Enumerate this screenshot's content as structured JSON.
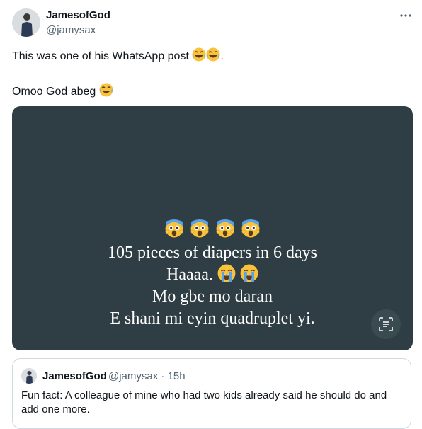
{
  "tweet": {
    "author_name": "JamesofGod",
    "author_handle": "@jamysax",
    "line1": "This was one of his WhatsApp post",
    "line1_suffix": ".",
    "line2": "Omoo God abeg",
    "more_icon": "ellipsis-icon"
  },
  "media": {
    "line1": "105 pieces of diapers in 6 days",
    "line2": "Haaaa.",
    "line3": "Mo gbe mo daran",
    "line4": "E shani mi eyin quadruplet yi.",
    "scan_icon": "text-scan-icon",
    "background": "#2f3e44"
  },
  "quote": {
    "author_name": "JamesofGod",
    "meta": "@jamysax · 15h",
    "text": "Fun fact: A colleague of mine who had two kids already said he should do and add one more."
  }
}
